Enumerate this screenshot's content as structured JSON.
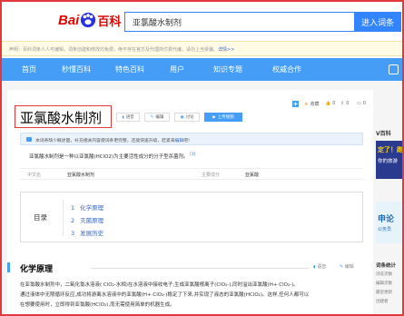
{
  "header": {
    "logo_bai": "Bai",
    "logo_ke": "百科",
    "search_value": "亚氯酸水制剂",
    "search_button": "进入词条"
  },
  "notice": {
    "text": "声明：百科词条人人可编辑，词条创建和修改均免费，绝不存在官方及代理商付费代编，请勿上当受骗。",
    "link": "详情>>"
  },
  "nav": {
    "items": [
      "首页",
      "秒懂百科",
      "特色百科",
      "用户",
      "知识专题",
      "权威合作"
    ]
  },
  "article": {
    "title": "亚氯酸水制剂",
    "actions": {
      "collect": "收藏",
      "collect_count": "0",
      "like_count": "0",
      "share_count": "0"
    },
    "title_buttons": [
      "语音",
      "编辑",
      "讨论",
      "上传视频"
    ],
    "infobar": {
      "text": "本词条缺少概述图，补充相关内容使词条更完整，还能快速升级，赶紧来",
      "link": "编辑",
      "suffix": "吧！"
    },
    "summary": "亚氯酸水制剂是一种以亚氯酸(HClO2)为主要活性成分的分子型杀菌剂。",
    "summary_ref": "[1]",
    "basic_info": {
      "name_label": "中文名",
      "name_value": "亚氯酸水制剂",
      "component_label": "主要成分",
      "component_value": "亚氯酸"
    },
    "toc": {
      "heading": "目录",
      "items": [
        {
          "num": "1",
          "label": "化学原理"
        },
        {
          "num": "2",
          "label": "灭菌原理"
        },
        {
          "num": "3",
          "label": "发展历史"
        }
      ]
    },
    "section1": {
      "title": "化学原理",
      "voice": "语音",
      "edit": "编辑",
      "lines": [
        "在亚氯酸水制剂中，二氧化氯水溶液( ClO₂-水相)在水溶液中接收电子,生成亚氯酸根离子(ClO₂-),同时溢出亚氯酸(H+·ClO₂-)。",
        "通过液体中无限循环反应,成功将游离水溶液中的亚氯酸(H+·ClO₂-)稳定了下来,并实现了液态的亚氯酸(HClO₂)。这样,任何人都可以",
        "在想要使用时，立即得到亚氯酸(HClO₂),而无需使用简单的机器生成。"
      ],
      "link_text": "二氧化氯"
    }
  },
  "sidebar": {
    "ad_title": "V百科",
    "ad1": "定了！跑",
    "ad1b": "你的旅游",
    "ad2": "申论",
    "ad2b": "公务员",
    "stats_title": "词条统计",
    "stats": [
      "浏览次数",
      "编辑次数",
      "最近更新",
      "创建者"
    ]
  },
  "colors": {
    "brand_red": "#e10601",
    "nav_blue": "#459df5",
    "link_blue": "#3366cc",
    "highlight_red": "#e4393c"
  }
}
